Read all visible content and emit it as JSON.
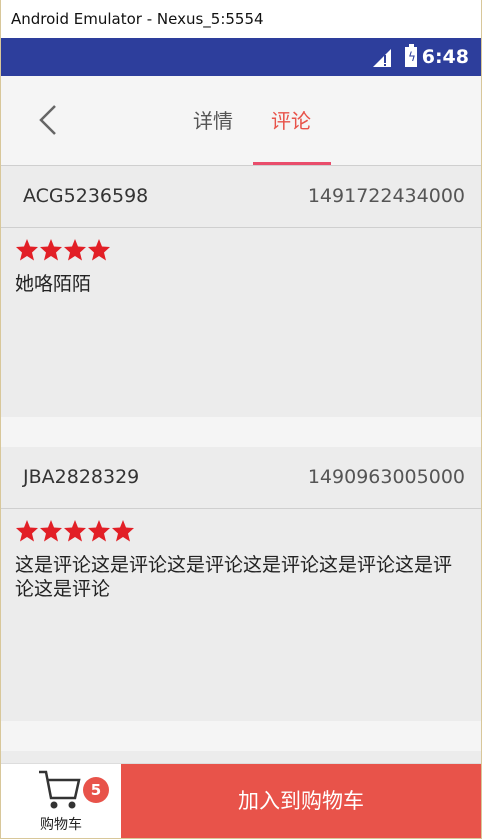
{
  "window": {
    "title": "Android Emulator - Nexus_5:5554"
  },
  "status": {
    "time": "6:48"
  },
  "tabs": {
    "detail": "详情",
    "comments": "评论"
  },
  "colors": {
    "statusbar": "#2d3e9c",
    "accent": "#e8534a",
    "tab_underline": "#e94d6b",
    "star": "#e21f26"
  },
  "comments": [
    {
      "user": "ACG5236598",
      "time": "1491722434000",
      "rating": 4,
      "text": "她咯陌陌"
    },
    {
      "user": "JBA2828329",
      "time": "1490963005000",
      "rating": 5,
      "text": "这是评论这是评论这是评论这是评论这是评论这是评论这是评论"
    }
  ],
  "bottom": {
    "cart_label": "购物车",
    "cart_count": "5",
    "add_to_cart": "加入到购物车"
  }
}
